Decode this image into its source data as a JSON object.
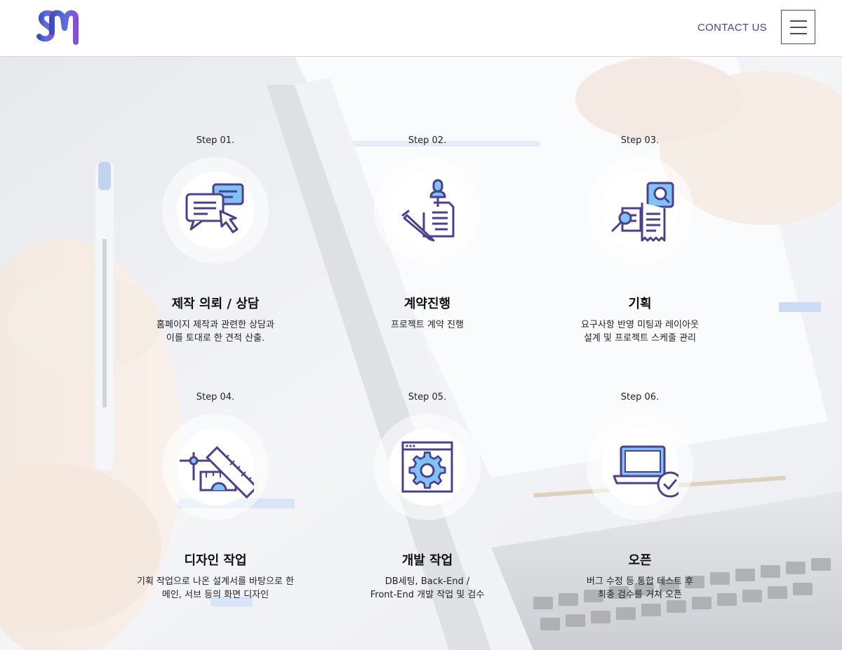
{
  "header": {
    "logo_alt": "SM",
    "contact_label": "CONTACT US",
    "menu_icon": "hamburger-menu-icon"
  },
  "colors": {
    "brand_purple": "#4b3f95",
    "brand_gradient_start": "#3b4fc4",
    "brand_gradient_end": "#8a4fd8",
    "icon_stroke": "#4b3f95",
    "icon_fill_blue": "#7ec3f2"
  },
  "steps": [
    {
      "label": "Step 01.",
      "icon": "consultation-chat-icon",
      "title": "제작 의뢰 / 상담",
      "desc": [
        "홈페이지 제작과 관련한 상담과",
        "이를 토대로 한 견적 산출."
      ]
    },
    {
      "label": "Step 02.",
      "icon": "contract-document-icon",
      "title": "계약진행",
      "desc": [
        "프로젝트 계약 진행"
      ]
    },
    {
      "label": "Step 03.",
      "icon": "planning-search-icon",
      "title": "기획",
      "desc": [
        "요구사항 반영 미팅과 레이아웃",
        "설계 및 프로젝트 스케줄 관리"
      ]
    },
    {
      "label": "Step 04.",
      "icon": "design-ruler-icon",
      "title": "디자인 작업",
      "desc": [
        "기획 작업으로 나온 설계서를 바탕으로 한",
        "메인, 서브 등의 화면 디자인"
      ]
    },
    {
      "label": "Step 05.",
      "icon": "development-gear-icon",
      "title": "개발 작업",
      "desc": [
        "DB세팅, Back-End /",
        "Front-End 개발 작업 및 검수"
      ]
    },
    {
      "label": "Step 06.",
      "icon": "launch-laptop-check-icon",
      "title": "오픈",
      "desc": [
        "버그 수정 등 통합 테스트 후",
        "최종 검수를 거쳐 오픈"
      ]
    }
  ]
}
